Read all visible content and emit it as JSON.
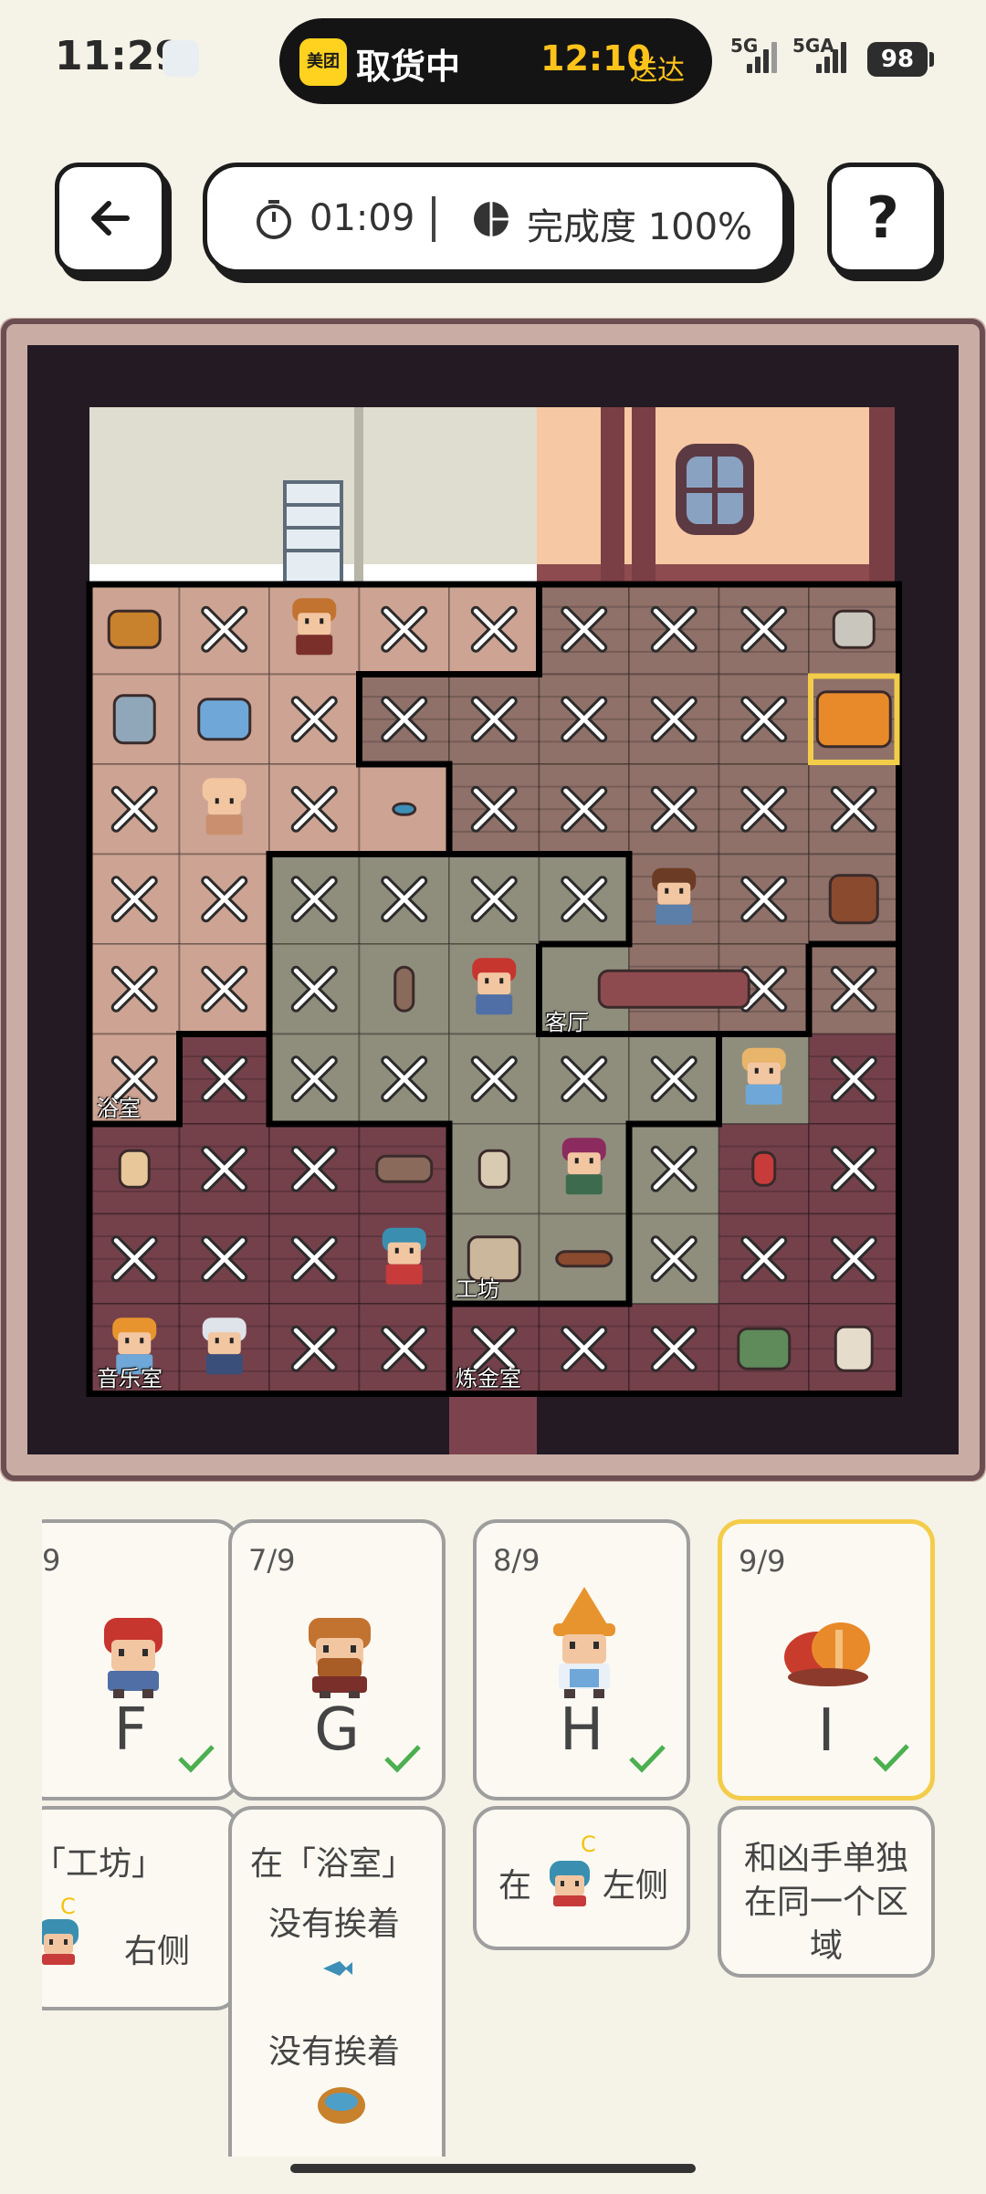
{
  "status_bar": {
    "time": "11:29",
    "app_logo": "美团",
    "pill_title": "取货中",
    "pill_eta": "12:10",
    "pill_eta_suffix": "送达",
    "signal_1": "5G",
    "signal_2": "5GA",
    "battery": "98"
  },
  "toolbar": {
    "back_icon": "back-arrow-icon",
    "timer": "01:09",
    "completion": "完成度 100%",
    "help_label": "?"
  },
  "board": {
    "rooms": {
      "bathroom": "浴室",
      "living_room": "客厅",
      "workshop": "工坊",
      "music_room": "音乐室",
      "alchemy_room": "炼金室"
    },
    "colors": {
      "frame": "#c9ada4",
      "dark_bg": "#241a24",
      "wall_cream": "#dfddcf",
      "wall_peach": "#f6c8a3",
      "floor_light": "#cda393",
      "floor_plank": "#8f7169",
      "floor_green": "#8f8e7d",
      "floor_dark": "#74414b"
    }
  },
  "cards": [
    {
      "count": "9",
      "letter": "F",
      "clue_lines": [
        "「工坊」",
        "右侧"
      ],
      "clue_mark": "C"
    },
    {
      "count": "7/9",
      "letter": "G",
      "clue_lines": [
        "在「浴室」",
        "没有挨着",
        "没有挨着"
      ]
    },
    {
      "count": "8/9",
      "letter": "H",
      "clue_lines": [
        "在",
        "左侧"
      ],
      "clue_mark": "C"
    },
    {
      "count": "9/9",
      "letter": "I",
      "clue_lines": [
        "和凶手单独",
        "在同一个区",
        "域"
      ],
      "selected": true
    }
  ]
}
